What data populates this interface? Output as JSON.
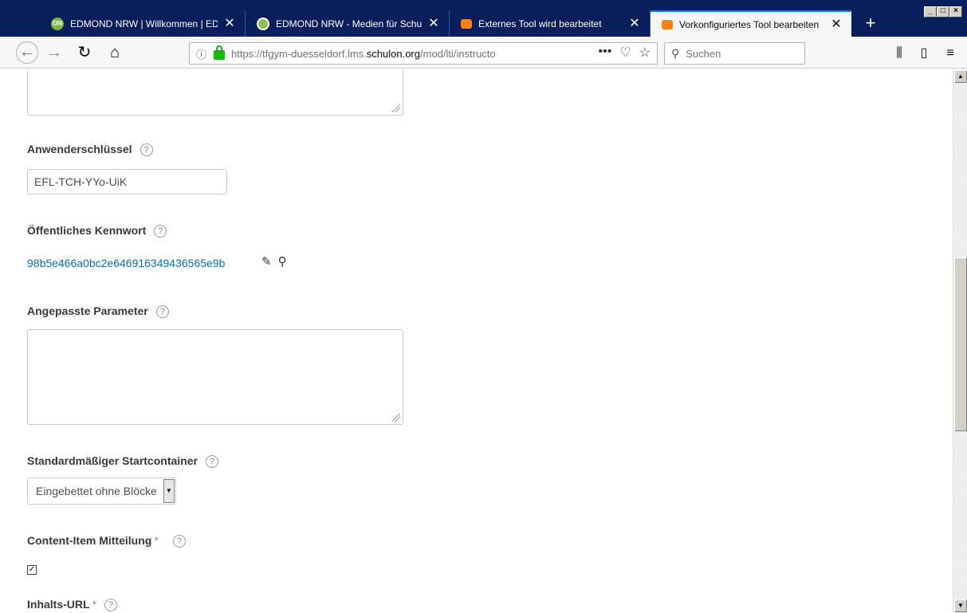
{
  "browser": {
    "tabs": [
      {
        "title": "EDMOND NRW | Willkommen | EDI",
        "favicon": "EDMOND",
        "active": false
      },
      {
        "title": "EDMOND NRW - Medien für Schul",
        "favicon": "EDMOND-green",
        "active": false
      },
      {
        "title": "Externes Tool wird bearbeitet",
        "favicon": "moodle",
        "active": false
      },
      {
        "title": "Vorkonfiguriertes Tool bearbeiten",
        "favicon": "moodle",
        "active": true
      }
    ],
    "new_tab": "+",
    "window_controls": [
      "_",
      "□",
      "×"
    ],
    "url_prefix": "https://tfgym-duesseldorf.lms.",
    "url_domain": "schulon.org",
    "url_suffix": "/mod/lti/instructo",
    "url_actions": [
      "•••",
      "♡",
      "☆"
    ],
    "search_placeholder": "Suchen"
  },
  "form": {
    "anwender_label": "Anwenderschlüssel",
    "anwender_value": "EFL-TCH-YYo-UiK",
    "kennwort_label": "Öffentliches Kennwort",
    "kennwort_value": "98b5e466a0bc2e646916349436565e9b",
    "parameter_label": "Angepasste Parameter",
    "startcontainer_label": "Standardmäßiger Startcontainer",
    "startcontainer_value": "Eingebettet ohne Blöcke",
    "contentitem_label": "Content-Item Mitteilung",
    "contentitem_checked": true,
    "inhaltsurl_label": "Inhalts-URL",
    "required_mark": "*",
    "help_glyph": "?"
  }
}
